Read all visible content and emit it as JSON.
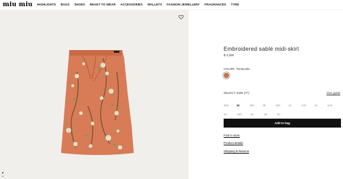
{
  "brand": {
    "logo": "miu miu"
  },
  "nav": [
    "HIGHLIGHTS",
    "BAGS",
    "SHOES",
    "READY TO WEAR",
    "ACCESSORIES",
    "WALLETS",
    "FASHION JEWELLERY",
    "FRAGRANCES",
    "TYRE"
  ],
  "product": {
    "title": "Embroidered sablé midi-skirt",
    "price": "$ 4,300",
    "color_label": "COLOR:",
    "color_value": "Terracotta",
    "swatch_color": "#c6764d",
    "size_label": "SELECT SIZE (IT):",
    "size_guide": "Size guide",
    "sizes_row1": [
      "36S",
      "36",
      "38S",
      "38",
      "40S",
      "40",
      "42S",
      "42",
      "44S"
    ],
    "sizes_row2": [
      "44",
      "46S",
      "46",
      "48",
      "50"
    ],
    "selected_size": "36",
    "add_to_bag": "Add to bag",
    "links": [
      "Find in store",
      "Product details",
      "Shipping & Returns"
    ]
  },
  "gallery": {
    "active_index": 0,
    "count": 2
  }
}
